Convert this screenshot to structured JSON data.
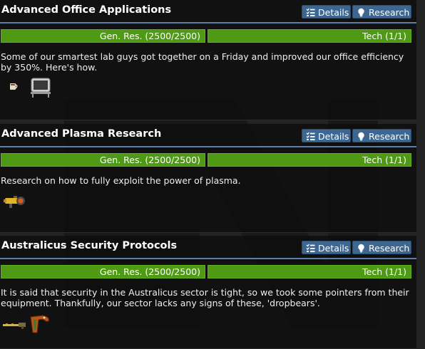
{
  "buttons": {
    "details_label": "Details",
    "research_label": "Research"
  },
  "colors": {
    "progress_bar": "#4e9a14",
    "button": "#3d6690",
    "header_rule": "#5a7fa8",
    "background": "#232323"
  },
  "cards": [
    {
      "title": "Advanced Office Applications",
      "gen_res": "Gen. Res. (2500/2500)",
      "tech": "Tech (1/1)",
      "description": "Some of our smartest lab guys got together on a Friday and improved our office efficiency by 350%. Here's how.",
      "items": [
        "mug-icon",
        "office-chair-icon"
      ]
    },
    {
      "title": "Advanced Plasma Research",
      "gen_res": "Gen. Res. (2500/2500)",
      "tech": "Tech (1/1)",
      "description": "Research on how to fully exploit the power of plasma.",
      "items": [
        "plasma-gun-icon"
      ]
    },
    {
      "title": "Australicus Security Protocols",
      "gen_res": "Gen. Res. (2500/2500)",
      "tech": "Tech (1/1)",
      "description": "It is said that security in the Australicus sector is tight, so we took some pointers from their equipment. Thankfully, our sector lacks any signs of these, 'dropbears'.",
      "items": [
        "rifle-icon",
        "boomerang-icon"
      ]
    }
  ]
}
